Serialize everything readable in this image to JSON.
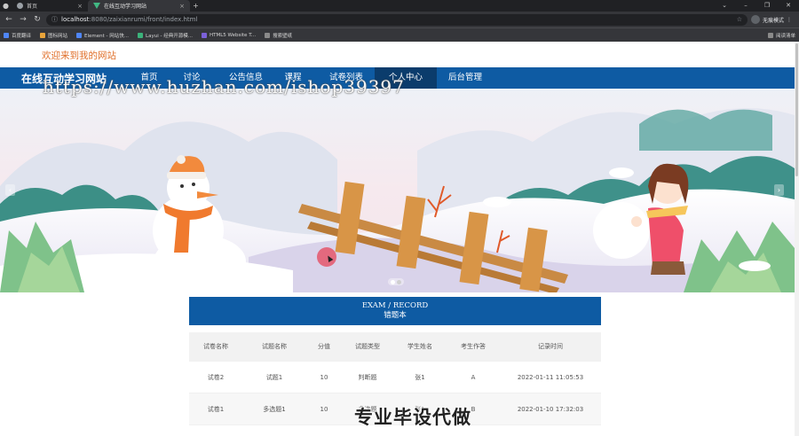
{
  "browser": {
    "tabs": [
      {
        "label": "首页",
        "active": false
      },
      {
        "label": "在线互动学习网站",
        "active": true
      }
    ],
    "new_tab": "+",
    "url_host": "localhost",
    "url_path": ":8080/zaixianrumi/front/index.html",
    "profile_label": "无痕模式",
    "bookmarks": [
      "百度翻译",
      "图标网站",
      "Element - 网站快...",
      "Layui - 经典开源模...",
      "HTML5 Website T...",
      "搜索壁纸"
    ],
    "bookmarks_right": "阅读清单"
  },
  "page": {
    "welcome": "欢迎来到我的网站",
    "site_title": "在线互动学习网站",
    "nav": [
      "首页",
      "讨论",
      "公告信息",
      "课程",
      "试卷列表",
      "个人中心",
      "后台管理"
    ],
    "nav_active": "个人中心",
    "watermark": "https://www.huzhan.com/ishop39397",
    "carousel": {
      "prev": "‹",
      "next": "›"
    },
    "section": {
      "title_en": "EXAM / RECORD",
      "title_zh": "错题本"
    },
    "table": {
      "headers": [
        "试卷名称",
        "试题名称",
        "分值",
        "试题类型",
        "学生姓名",
        "考生作答",
        "记录时间"
      ],
      "rows": [
        [
          "试卷2",
          "试题1",
          "10",
          "判断题",
          "张1",
          "A",
          "2022-01-11 11:05:53"
        ],
        [
          "试卷1",
          "多选题1",
          "10",
          "多选题",
          "张1",
          "B",
          "2022-01-10 17:32:03"
        ]
      ]
    },
    "overlay": "专业毕设代做"
  }
}
